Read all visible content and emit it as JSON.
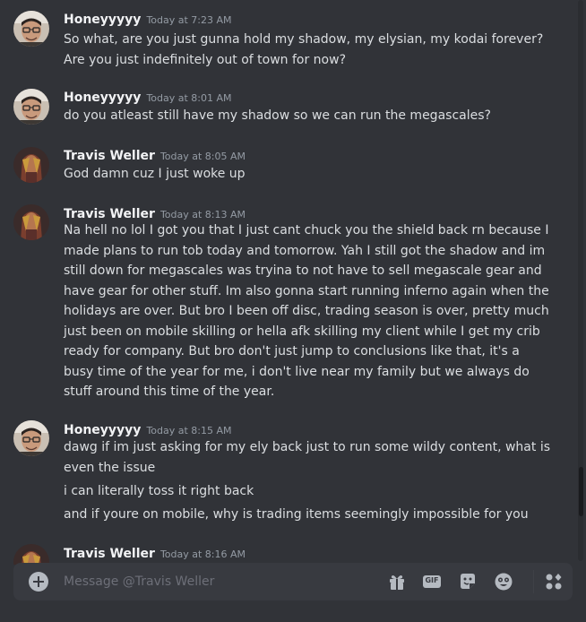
{
  "messages": [
    {
      "author": "Honeyyyyy",
      "timestamp": "Today at 7:23 AM",
      "lines": [
        "So what, are you just gunna hold my shadow, my elysian, my kodai forever?",
        "Are you just indefinitely out of town for now?"
      ]
    },
    {
      "author": "Honeyyyyy",
      "timestamp": "Today at 8:01 AM",
      "lines": [
        "do you atleast still have my shadow so we can run the megascales?"
      ]
    },
    {
      "author": "Travis Weller",
      "timestamp": "Today at 8:05 AM",
      "lines": [
        "God damn cuz I just woke up"
      ]
    },
    {
      "author": "Travis Weller",
      "timestamp": "Today at 8:13 AM",
      "lines": [
        "Na hell no lol I got you that I just cant chuck you the shield back rn because I",
        "made plans to run tob today and tomorrow. Yah I still got the shadow and im",
        "still down for megascales was tryina to not have to sell megascale gear and",
        "have gear for other stuff. Im also gonna start running inferno again when the",
        "holidays are over. But bro I been off disc, trading season is over, pretty much",
        "just been on mobile skilling or hella afk skilling my client while I get my crib",
        "ready for company. But bro don't just jump to conclusions like that, it's a",
        "busy time of the year for me, i don't live near my family but we always do",
        "stuff around this time of the year."
      ]
    },
    {
      "author": "Honeyyyyy",
      "timestamp": "Today at 8:15 AM",
      "lines": [
        "dawg if im just asking for my ely back just to run some wildy content, what is",
        "even the issue"
      ],
      "followups": [
        "i can literally toss it right back",
        "and if youre on mobile, why is trading items seemingly impossible for you"
      ]
    },
    {
      "author": "Travis Weller",
      "timestamp": "Today at 8:16 AM",
      "lines": []
    }
  ],
  "composer": {
    "placeholder": "Message @Travis Weller",
    "gift_icon": "gift-icon",
    "gif_label": "GIF",
    "sticker_icon": "sticker-icon",
    "emoji_icon": "emoji-icon",
    "apps_icon": "apps-icon"
  }
}
